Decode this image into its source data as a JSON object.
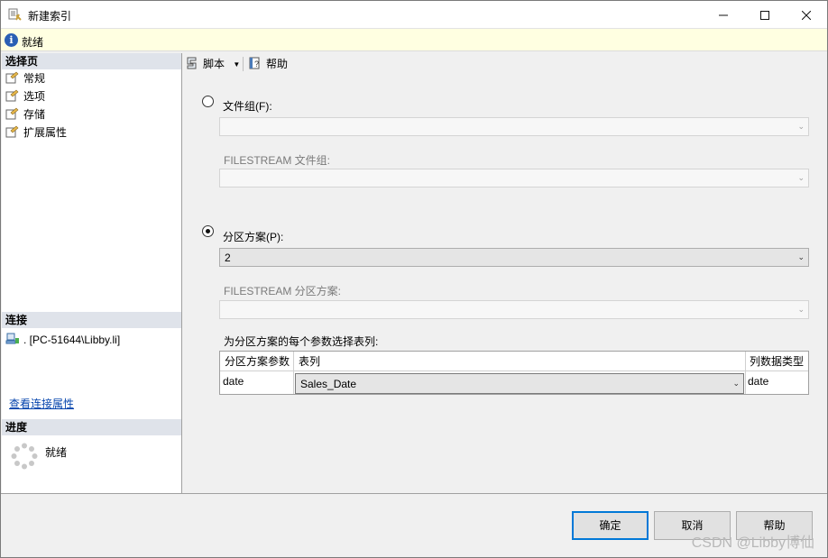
{
  "window": {
    "title": "新建索引",
    "status": "就绪"
  },
  "left": {
    "select_page_header": "选择页",
    "pages": [
      "常规",
      "选项",
      "存储",
      "扩展属性"
    ],
    "connection_header": "连接",
    "connection_server": ". [PC-51644\\Libby.li]",
    "view_connection_link": "查看连接属性",
    "progress_header": "进度",
    "progress_status": "就绪"
  },
  "toolbar": {
    "script_label": "脚本",
    "help_label": "帮助"
  },
  "form": {
    "filegroup_label": "文件组(F):",
    "filegroup_value": "",
    "filestream_filegroup_label": "FILESTREAM 文件组:",
    "filestream_filegroup_value": "",
    "partition_scheme_label": "分区方案(P):",
    "partition_scheme_value": "2",
    "filestream_partition_label": "FILESTREAM 分区方案:",
    "filestream_partition_value": "",
    "param_table_caption": "为分区方案的每个参数选择表列:",
    "param_table_headers": [
      "分区方案参数",
      "表列",
      "列数据类型"
    ],
    "param_table_rows": [
      {
        "param": "date",
        "column": "Sales_Date",
        "type": "date"
      }
    ],
    "selected_option": "partition_scheme"
  },
  "buttons": {
    "ok": "确定",
    "cancel": "取消",
    "help": "帮助"
  },
  "watermark": "CSDN @Libby博仙",
  "colors": {
    "accent": "#0078d7",
    "status_bg": "#ffffe1",
    "header_bg": "#dfe3ea",
    "link": "#0645ad"
  }
}
